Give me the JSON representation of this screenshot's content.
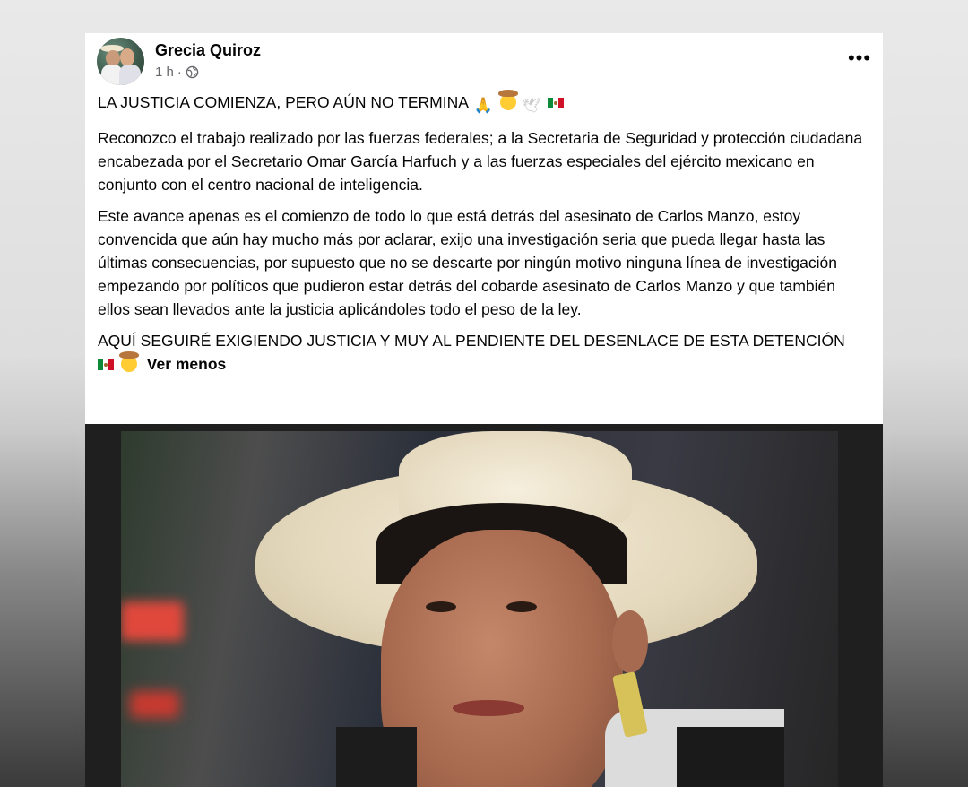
{
  "post": {
    "author": "Grecia Quiroz",
    "timestamp": "1 h",
    "meta_separator": "·",
    "audience_icon": "globe-icon",
    "more_icon": "more-options-icon",
    "headline": "LA JUSTICIA COMIENZA, PERO AÚN NO TERMINA",
    "headline_emojis": [
      "folded-hands",
      "cowboy-face",
      "dove",
      "mexico-flag"
    ],
    "paragraph_1": "Reconozco el trabajo realizado por las fuerzas federales; a la Secretaria de Seguridad y protección ciudadana encabezada por el Secretario Omar García Harfuch y a las fuerzas especiales del ejército mexicano en conjunto con el centro nacional de inteligencia.",
    "paragraph_2": "Este avance apenas es el comienzo de todo lo que está detrás del asesinato de Carlos Manzo, estoy convencida que aún hay mucho más por aclarar, exijo una investigación seria que pueda llegar hasta las últimas consecuencias, por supuesto que no se descarte por ningún motivo ninguna línea de investigación empezando por políticos que pudieron estar detrás del cobarde asesinato de Carlos Manzo y que también ellos sean llevados ante la justicia aplicándoles todo el peso de la ley.",
    "closing": "AQUÍ SEGUIRÉ EXIGIENDO JUSTICIA Y MUY AL PENDIENTE DEL DESENLACE DE ESTA DETENCIÓN",
    "closing_emojis": [
      "mexico-flag",
      "cowboy-face"
    ],
    "see_less": "Ver menos"
  },
  "colors": {
    "text": "#050505",
    "meta": "#65676b",
    "card": "#ffffff"
  }
}
